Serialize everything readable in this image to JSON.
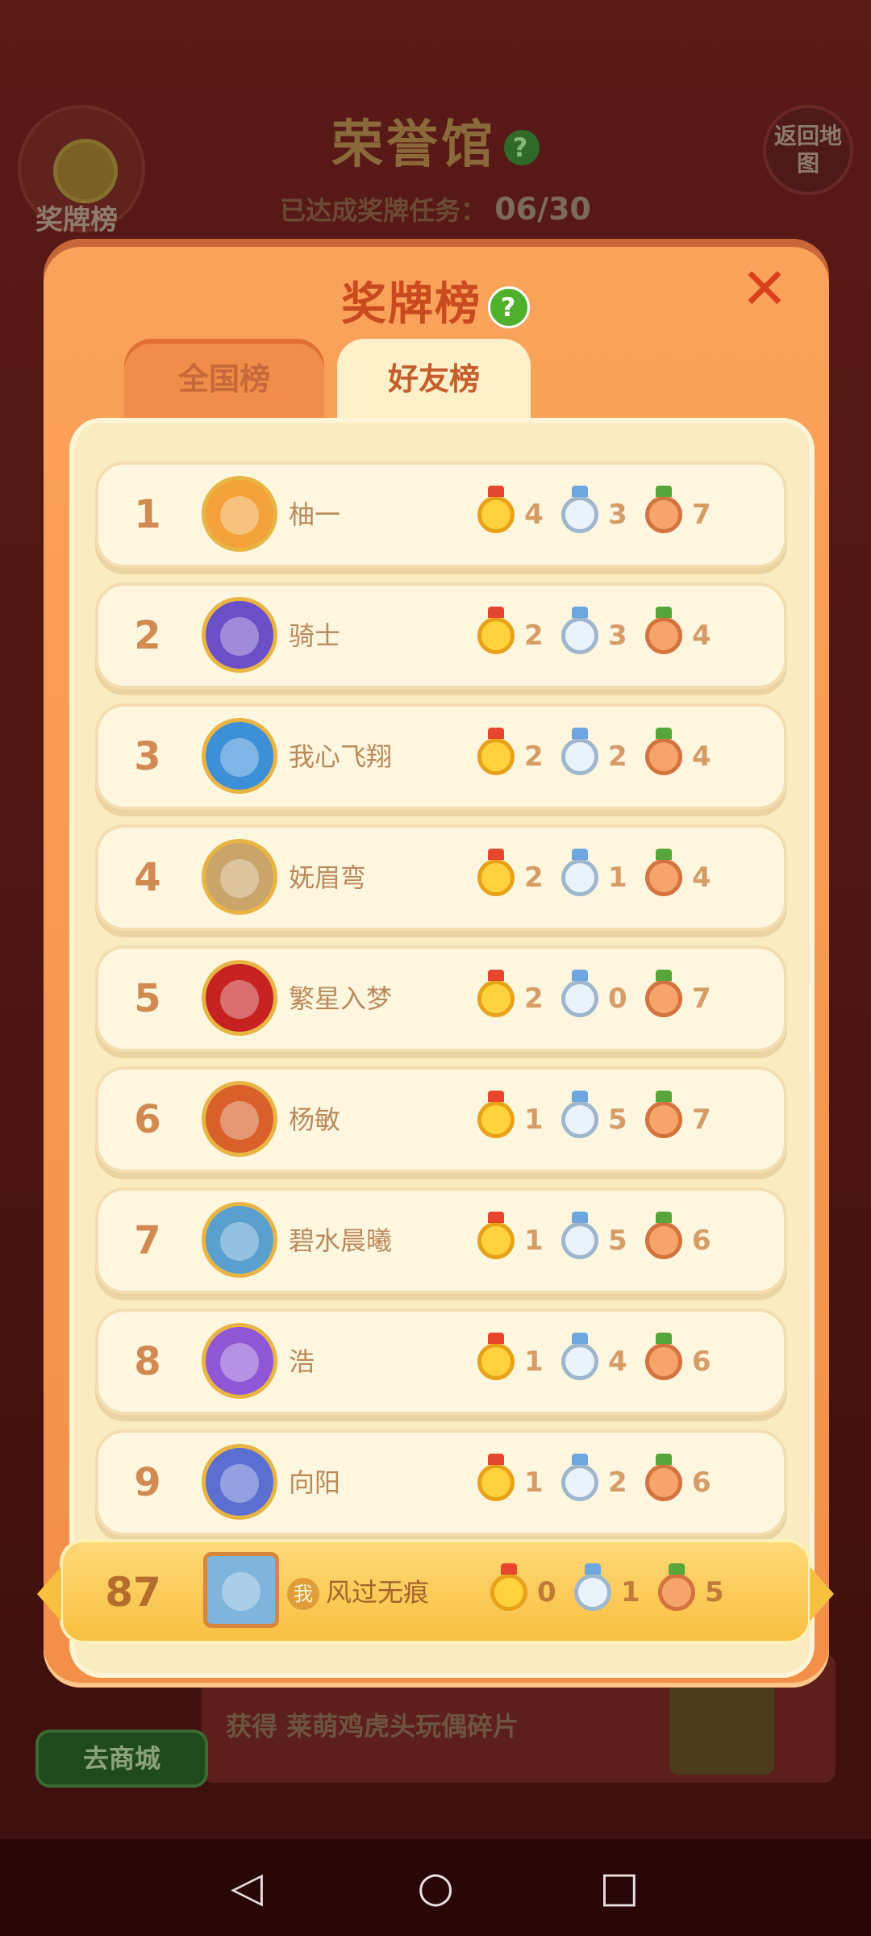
{
  "background": {
    "title": "荣誉馆",
    "title_help": "?",
    "medal_button_label": "奖牌榜",
    "back_button_label": "返回地图",
    "progress_label": "已达成奖牌任务：",
    "progress_value": "06/30",
    "reward_text": "获得 莱萌鸡虎头玩偶碎片",
    "shop_button": "去商城"
  },
  "modal": {
    "title": "奖牌榜",
    "help": "?",
    "close": "✕",
    "tabs": [
      {
        "label": "全国榜",
        "active": false
      },
      {
        "label": "好友榜",
        "active": true
      }
    ]
  },
  "leaderboard": [
    {
      "rank": "1",
      "name": "柚一",
      "gold": "4",
      "silver": "3",
      "bronze": "7",
      "avatar_color": "#f3a13a"
    },
    {
      "rank": "2",
      "name": "骑士",
      "gold": "2",
      "silver": "3",
      "bronze": "4",
      "avatar_color": "#6a4fc7"
    },
    {
      "rank": "3",
      "name": "我心飞翔",
      "gold": "2",
      "silver": "2",
      "bronze": "4",
      "avatar_color": "#3d8fd8"
    },
    {
      "rank": "4",
      "name": "妩眉弯",
      "gold": "2",
      "silver": "1",
      "bronze": "4",
      "avatar_color": "#c9a56a"
    },
    {
      "rank": "5",
      "name": "繁星入梦",
      "gold": "2",
      "silver": "0",
      "bronze": "7",
      "avatar_color": "#c62222"
    },
    {
      "rank": "6",
      "name": "杨敏",
      "gold": "1",
      "silver": "5",
      "bronze": "7",
      "avatar_color": "#d9602a"
    },
    {
      "rank": "7",
      "name": "碧水晨曦",
      "gold": "1",
      "silver": "5",
      "bronze": "6",
      "avatar_color": "#5aa0cf"
    },
    {
      "rank": "8",
      "name": "浩",
      "gold": "1",
      "silver": "4",
      "bronze": "6",
      "avatar_color": "#8f56d6"
    },
    {
      "rank": "9",
      "name": "向阳",
      "gold": "1",
      "silver": "2",
      "bronze": "6",
      "avatar_color": "#5a6fd0"
    }
  ],
  "my_entry": {
    "rank": "87",
    "me_badge": "我",
    "name": "风过无痕",
    "gold": "0",
    "silver": "1",
    "bronze": "5",
    "avatar_color": "#7fb4dc"
  },
  "navbar": {
    "back": "◁",
    "home": "○",
    "recent": "□"
  }
}
